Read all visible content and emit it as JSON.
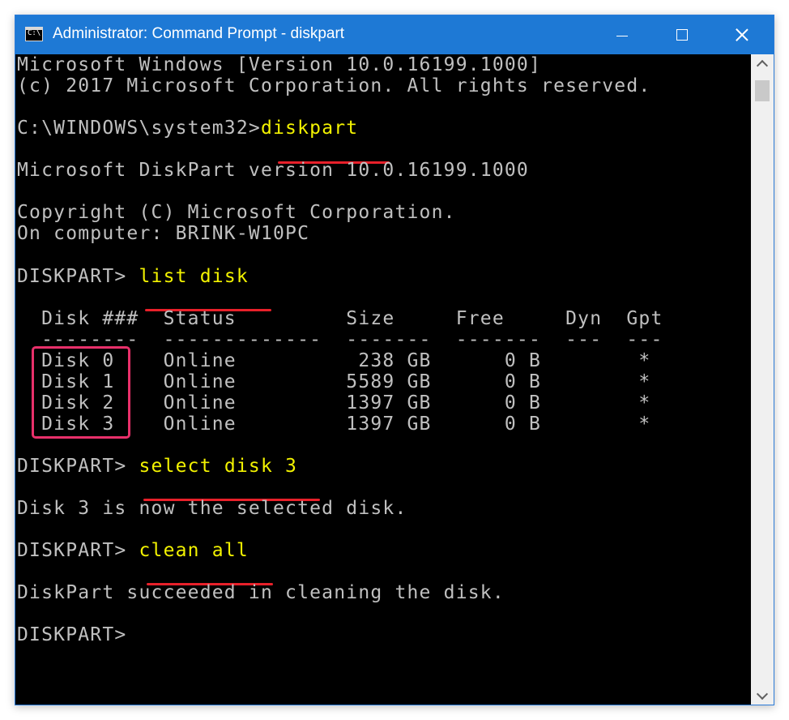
{
  "window": {
    "title": "Administrator: Command Prompt - diskpart",
    "icon_name": "cmd-icon",
    "icon_text": "C:\\.",
    "controls": [
      "minimize-icon",
      "maximize-icon",
      "close-icon"
    ]
  },
  "colors": {
    "titlebar": "#1e79d5",
    "console_bg": "#000000",
    "console_text": "#c0c0c0",
    "command_text": "#f2f200",
    "annotation_underline": "#e8202a",
    "annotation_box": "#e8306a"
  },
  "console": {
    "lines": [
      {
        "text": "Microsoft Windows [Version 10.0.16199.1000]"
      },
      {
        "text": "(c) 2017 Microsoft Corporation. All rights reserved."
      },
      {
        "text": ""
      },
      {
        "prompt": "C:\\WINDOWS\\system32>",
        "cmd": "diskpart"
      },
      {
        "text": ""
      },
      {
        "text": "Microsoft DiskPart version 10.0.16199.1000"
      },
      {
        "text": ""
      },
      {
        "text": "Copyright (C) Microsoft Corporation."
      },
      {
        "text": "On computer: BRINK-W10PC"
      },
      {
        "text": ""
      },
      {
        "prompt": "DISKPART> ",
        "cmd": "list disk"
      },
      {
        "text": ""
      },
      {
        "text": "  Disk ###  Status         Size     Free     Dyn  Gpt"
      },
      {
        "text": "  --------  -------------  -------  -------  ---  ---"
      },
      {
        "text": "  Disk 0    Online          238 GB      0 B        *"
      },
      {
        "text": "  Disk 1    Online         5589 GB      0 B        *"
      },
      {
        "text": "  Disk 2    Online         1397 GB      0 B        *"
      },
      {
        "text": "  Disk 3    Online         1397 GB      0 B        *"
      },
      {
        "text": ""
      },
      {
        "prompt": "DISKPART> ",
        "cmd": "select disk 3"
      },
      {
        "text": ""
      },
      {
        "text": "Disk 3 is now the selected disk."
      },
      {
        "text": ""
      },
      {
        "prompt": "DISKPART> ",
        "cmd": "clean all"
      },
      {
        "text": ""
      },
      {
        "text": "DiskPart succeeded in cleaning the disk."
      },
      {
        "text": ""
      },
      {
        "prompt": "DISKPART> ",
        "cmd": ""
      }
    ]
  }
}
